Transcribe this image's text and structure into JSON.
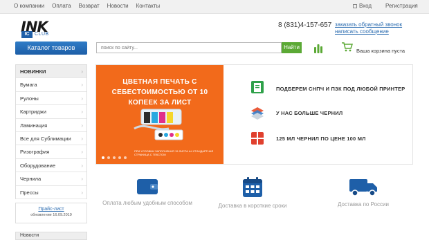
{
  "topnav": {
    "items": [
      "О компании",
      "Оплата",
      "Возврат",
      "Новости",
      "Контакты"
    ],
    "login": "Вход",
    "register": "Регистрация"
  },
  "logo": {
    "main": "INK",
    "ic": "IC",
    "sub": "CLUB"
  },
  "header": {
    "phone": "8 (831)4-157-657",
    "callback": "заказать обратный звонок",
    "write_msg": "написать сообщение"
  },
  "catalog": {
    "label": "Каталог товаров"
  },
  "search": {
    "placeholder": "поиск по сайту...",
    "button": "Найти"
  },
  "cart": {
    "text": "Ваша корзина пуста"
  },
  "sidebar": {
    "items": [
      "НОВИНКИ",
      "Бумага",
      "Рулоны",
      "Картриджи",
      "Ламинация",
      "Все для Сублимации",
      "Ризография",
      "Оборудование",
      "Чернила",
      "Прессы"
    ]
  },
  "price": {
    "link": "Прайс-лист",
    "date": "обновление 16.09.2019"
  },
  "news": {
    "title": "Новости"
  },
  "banner": {
    "title": "ЦВЕТНАЯ ПЕЧАТЬ С СЕБЕСТОИМОСТЬЮ ОТ 10 КОПЕЕК ЗА ЛИСТ",
    "note": "ПРИ УСЛОВИИ ЗАПОЛНЕНИЯ 15 ЛИСТА А4 СТАНДАРТНАЯ СТРАНИЦА С ТЕКСТОМ",
    "features": [
      "ПОДБЕРЕМ СНПЧ И ПЗК ПОД ЛЮБОЙ ПРИНТЕР",
      "У НАС БОЛЬШЕ ЧЕРНИЛ",
      "125 МЛ ЧЕРНИЛ ПО ЦЕНЕ 100 МЛ"
    ]
  },
  "services": [
    {
      "label": "Оплата любым удобным способом",
      "icon": "wallet-icon"
    },
    {
      "label": "Доставка в короткие сроки",
      "icon": "calendar-icon"
    },
    {
      "label": "Доставка по России",
      "icon": "truck-icon"
    }
  ],
  "colors": {
    "accent": "#1e5fa8",
    "orange": "#f26a1b",
    "green": "#5ba935"
  }
}
